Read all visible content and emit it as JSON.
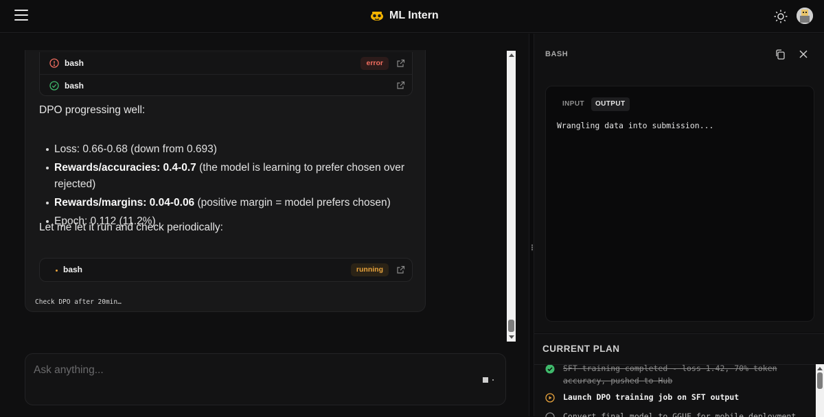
{
  "header": {
    "title": "ML Intern"
  },
  "chat": {
    "tool_calls": [
      {
        "name": "bash",
        "status": "error",
        "badge": "error"
      },
      {
        "name": "bash",
        "status": "success",
        "badge": ""
      }
    ],
    "intro": "DPO progressing well:",
    "bullets": [
      {
        "bold": "",
        "text": "Loss: 0.66-0.68 (down from 0.693)"
      },
      {
        "bold": "Rewards/accuracies: 0.4-0.7",
        "text": " (the model is learning to prefer chosen over rejected)"
      },
      {
        "bold": "Rewards/margins: 0.04-0.06",
        "text": " (positive margin = model prefers chosen)"
      },
      {
        "bold": "",
        "text": "Epoch: 0.112 (11.2%)"
      }
    ],
    "outro": "Let me let it run and check periodically:",
    "running_tool": {
      "name": "bash",
      "badge": "running"
    },
    "status_line": "Check DPO after 20min…"
  },
  "composer": {
    "placeholder": "Ask anything..."
  },
  "panel": {
    "title": "BASH",
    "tabs": [
      "INPUT",
      "OUTPUT"
    ],
    "active_tab": "OUTPUT",
    "output": "Wrangling data into submission..."
  },
  "plan": {
    "title": "CURRENT PLAN",
    "items": [
      {
        "status": "completed",
        "text": "SFT training completed - loss 1.42, 70% token accuracy, pushed to Hub"
      },
      {
        "status": "in_progress",
        "text": "Launch DPO training job on SFT output"
      },
      {
        "status": "pending",
        "text": "Convert final model to GGUF for mobile deployment"
      }
    ]
  },
  "colors": {
    "error": "#f26d5f",
    "success": "#3fb96b",
    "running": "#e8a33c"
  }
}
